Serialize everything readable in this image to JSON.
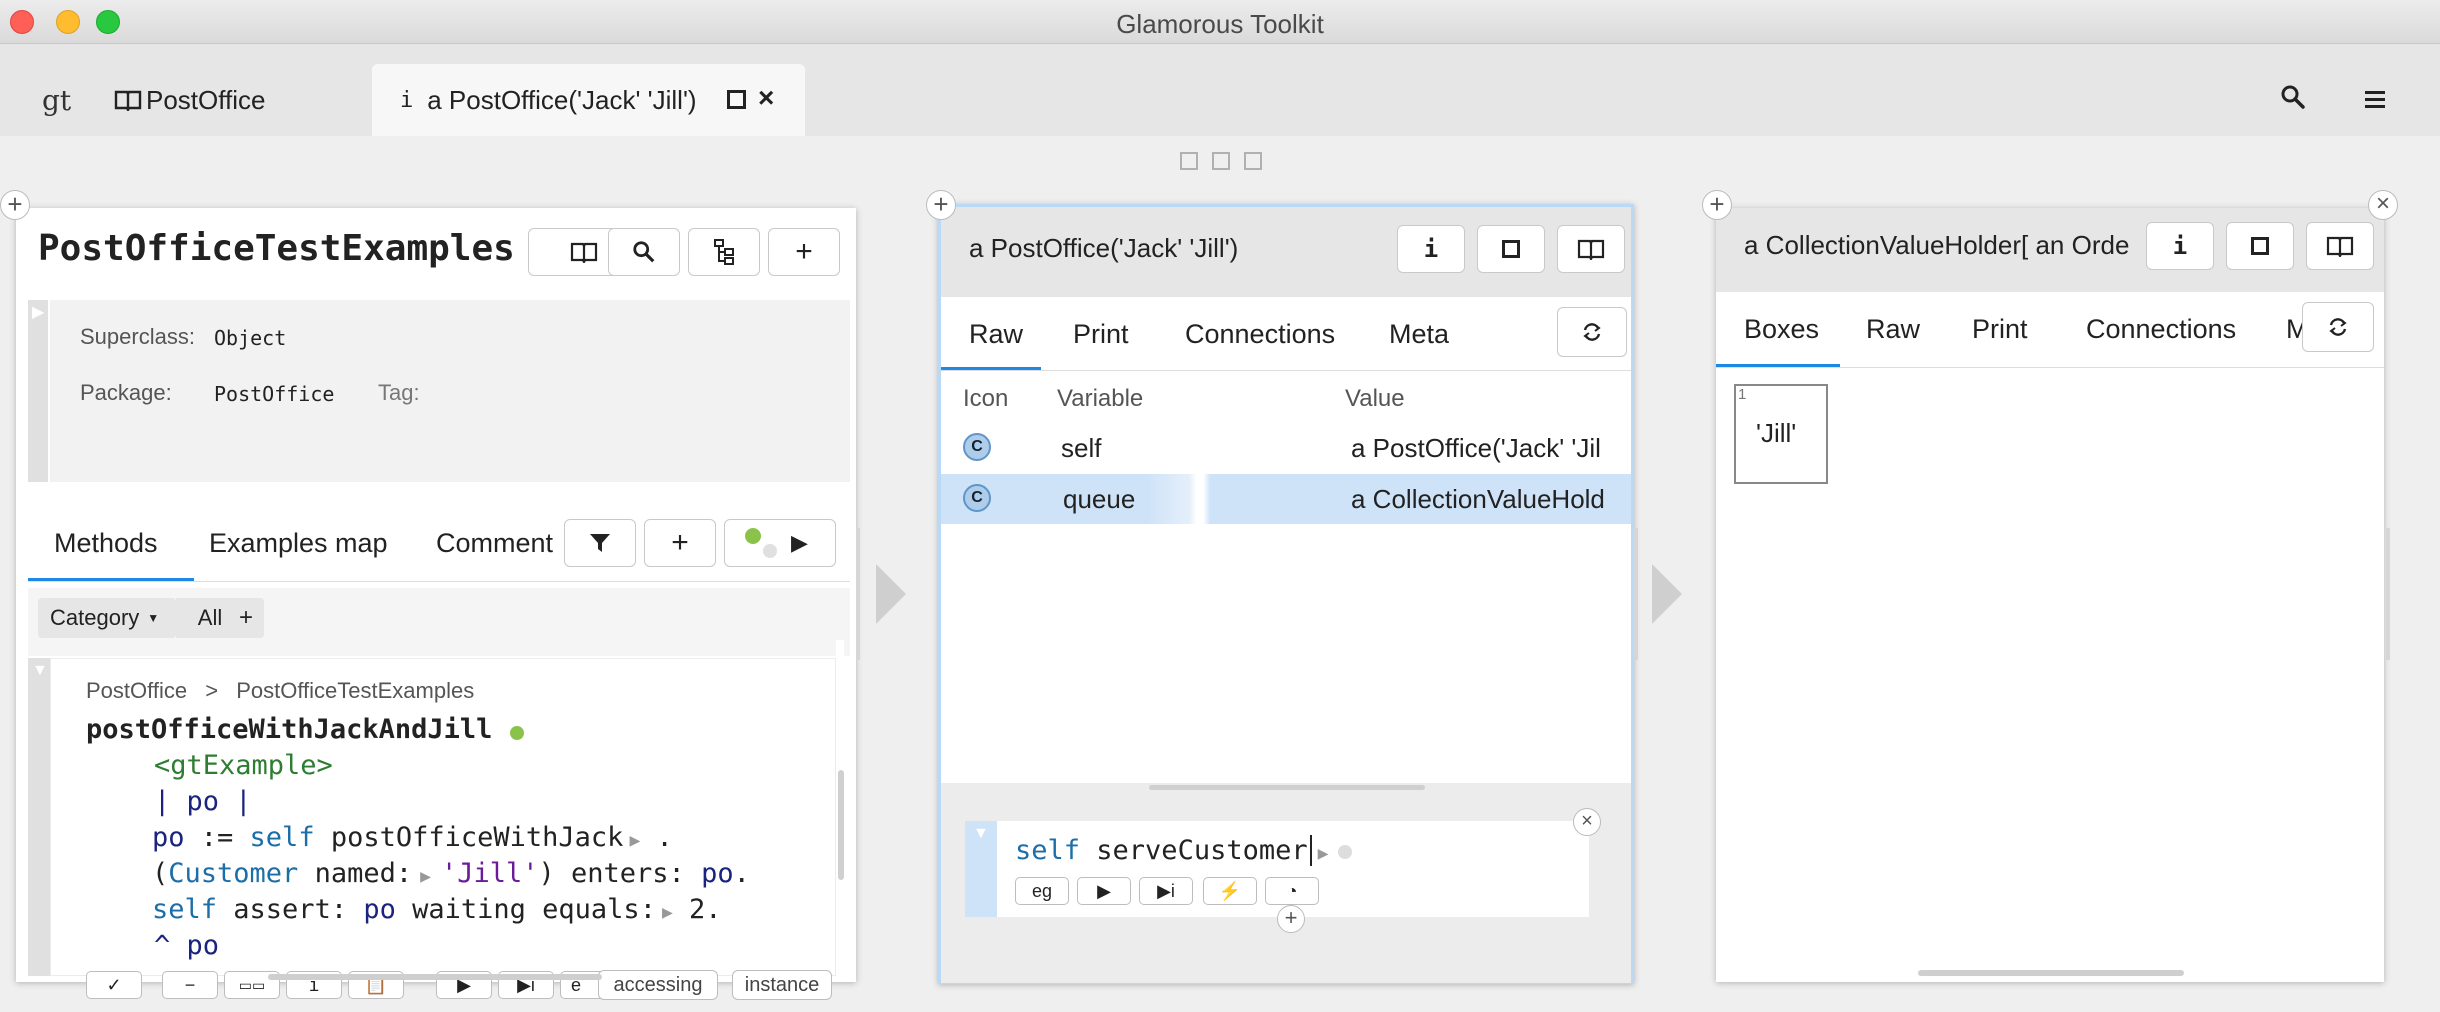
{
  "window": {
    "title": "Glamorous Toolkit"
  },
  "tabs": {
    "gt_label": "gt",
    "postoffice_label": "PostOffice",
    "active_prefix": "i",
    "active_label": "a PostOffice('Jack' 'Jill')"
  },
  "panel1": {
    "title": "PostOfficeTestExamples",
    "superclass_label": "Superclass:",
    "superclass_value": "Object",
    "package_label": "Package:",
    "package_value": "PostOffice",
    "tag_label": "Tag:",
    "tabs": [
      "Methods",
      "Examples map",
      "Comment"
    ],
    "filter_category": "Category",
    "filter_all": "All",
    "breadcrumb_package": "PostOffice",
    "breadcrumb_sep": ">",
    "breadcrumb_class": "PostOfficeTestExamples",
    "method_name": "postOfficeWithJackAndJill",
    "code": {
      "pragma": "<gtExample>",
      "temps": "| po |",
      "l3_var": "po",
      "l3_assign": " := ",
      "l3_self": "self",
      "l3_msg": " postOfficeWithJack",
      "l3_end": " .",
      "l4_open": "(",
      "l4_cls": "Customer",
      "l4_msg": " named:",
      "l4_str": "'Jill'",
      "l4_rest": ") enters: ",
      "l4_po": "po",
      "l4_end": ".",
      "l5_self": "self",
      "l5_msg": " assert: ",
      "l5_po": "po",
      "l5_rest": " waiting equals:",
      "l5_num": " 2.",
      "l6": "^ po"
    },
    "toolbar_e": "e",
    "tag_accessing": "accessing",
    "tag_instance": "instance"
  },
  "panel2": {
    "title": "a PostOffice('Jack' 'Jill')",
    "tabs": [
      "Raw",
      "Print",
      "Connections",
      "Meta"
    ],
    "columns": [
      "Icon",
      "Variable",
      "Value"
    ],
    "rows": [
      {
        "icon": "C",
        "variable": "self",
        "value": "a PostOffice('Jack' 'Jil"
      },
      {
        "icon": "C",
        "variable": "queue",
        "value": "a CollectionValueHold"
      }
    ],
    "snippet_self": "self",
    "snippet_msg": " serveCustomer",
    "snippet_buttons": [
      "eg"
    ]
  },
  "panel3": {
    "title": "a CollectionValueHolder[ an Orde",
    "tabs": [
      "Boxes",
      "Raw",
      "Print",
      "Connections",
      "M"
    ],
    "box_index": "1",
    "box_value": "'Jill'"
  },
  "colors": {
    "accent": "#1e88e5",
    "selected_row": "#cfe3f8",
    "pragma": "#2e7d32",
    "self": "#1b6ea8"
  }
}
